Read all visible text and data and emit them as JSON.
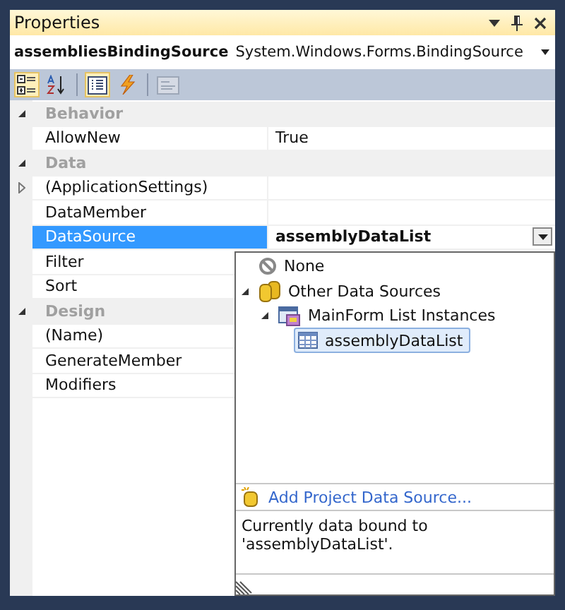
{
  "window": {
    "title": "Properties"
  },
  "selector": {
    "name": "assembliesBindingSource",
    "type": "System.Windows.Forms.BindingSource"
  },
  "toolbar": [
    {
      "kind": "categorized",
      "selected": true,
      "disabled": false
    },
    {
      "kind": "alphabetical",
      "selected": false,
      "disabled": false
    },
    {
      "kind": "properties",
      "selected": true,
      "disabled": false
    },
    {
      "kind": "events",
      "selected": false,
      "disabled": false
    },
    {
      "kind": "pages",
      "selected": false,
      "disabled": true
    }
  ],
  "grid": [
    {
      "kind": "category",
      "name": "Behavior",
      "expanded": true
    },
    {
      "kind": "property",
      "name": "AllowNew",
      "value": "True",
      "selected": false
    },
    {
      "kind": "category",
      "name": "Data",
      "expanded": true
    },
    {
      "kind": "property",
      "name": "(ApplicationSettings)",
      "expanded": false,
      "selected": false
    },
    {
      "kind": "property",
      "name": "DataMember",
      "selected": false
    },
    {
      "kind": "property",
      "name": "DataSource",
      "value": "assemblyDataList",
      "selected": true,
      "dropdown": true
    },
    {
      "kind": "property",
      "name": "Filter",
      "selected": false
    },
    {
      "kind": "property",
      "name": "Sort",
      "selected": false
    },
    {
      "kind": "category",
      "name": "Design",
      "expanded": true
    },
    {
      "kind": "property",
      "name": "(Name)",
      "selected": false
    },
    {
      "kind": "property",
      "name": "GenerateMember",
      "selected": false
    },
    {
      "kind": "property",
      "name": "Modifiers",
      "selected": false
    }
  ],
  "popup": {
    "tree": [
      {
        "kind": "none",
        "label": "None",
        "selected": false
      },
      {
        "kind": "folder",
        "label": "Other Data Sources",
        "selected": false,
        "expanded": true,
        "children": [
          {
            "kind": "form",
            "label": "MainForm List Instances",
            "selected": false,
            "expanded": true,
            "children": [
              {
                "kind": "table",
                "label": "assemblyDataList",
                "selected": true
              }
            ]
          }
        ]
      }
    ],
    "link": "Add Project Data Source...",
    "description": "Currently data bound to 'assemblyDataList'."
  }
}
